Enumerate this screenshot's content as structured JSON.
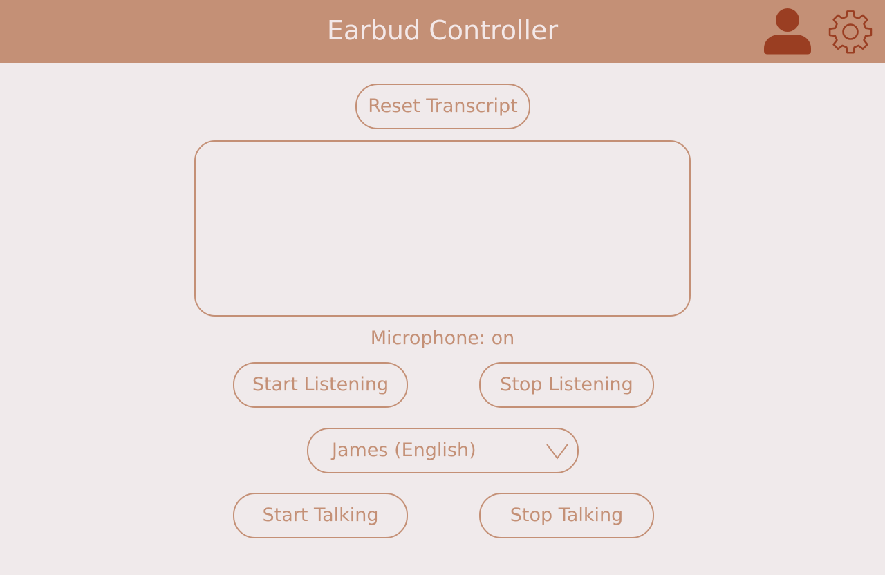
{
  "header": {
    "title": "Earbud Controller",
    "profile_icon": "user-icon",
    "settings_icon": "gear-icon"
  },
  "transcript": {
    "reset_label": "Reset Transcript",
    "value": "",
    "placeholder": ""
  },
  "microphone": {
    "status_text": "Microphone: on"
  },
  "listening": {
    "start_label": "Start Listening",
    "stop_label": "Stop Listening"
  },
  "voice": {
    "selected": "James (English)",
    "chevron_icon": "chevron-down-icon"
  },
  "talking": {
    "start_label": "Start Talking",
    "stop_label": "Stop Talking"
  },
  "colors": {
    "background": "#f0eaeb",
    "header": "#c49076",
    "accent": "#c49076",
    "icon_dark": "#9a3e22",
    "header_text": "#f3e8e8"
  }
}
